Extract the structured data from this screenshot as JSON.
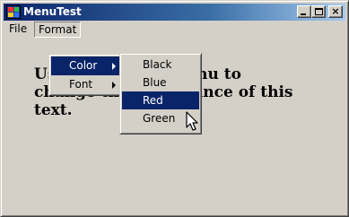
{
  "window": {
    "title": "MenuTest",
    "icon": "app-icon",
    "controls": {
      "minimize": "minimize-icon",
      "maximize": "maximize-icon",
      "close": "×"
    }
  },
  "menubar": {
    "items": [
      {
        "label": "File"
      },
      {
        "label": "Format"
      }
    ]
  },
  "format_menu": {
    "items": [
      {
        "label": "Color",
        "submenu": true,
        "highlighted": true
      },
      {
        "label": "Font",
        "submenu": true,
        "highlighted": false
      }
    ]
  },
  "color_menu": {
    "items": [
      {
        "label": "Black",
        "highlighted": false
      },
      {
        "label": "Blue",
        "highlighted": false
      },
      {
        "label": "Red",
        "highlighted": true
      },
      {
        "label": "Green",
        "highlighted": false
      }
    ]
  },
  "content": {
    "text": "Use the Format menu to change the appearance of this text."
  },
  "colors": {
    "highlight": "#0a246a",
    "title_gradient_start": "#0a246a",
    "title_gradient_end": "#a6caf0",
    "face": "#d4d0c8"
  }
}
